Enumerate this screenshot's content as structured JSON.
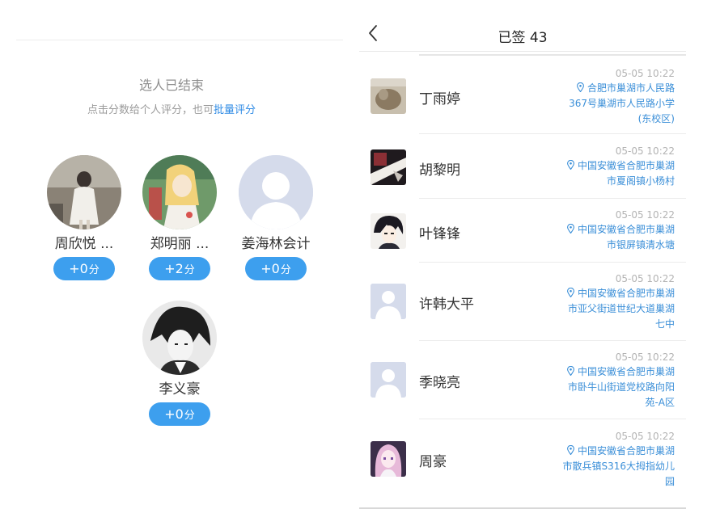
{
  "left": {
    "status_title": "选人已结束",
    "hint_prefix": "点击分数给个人评分，也可",
    "hint_link": "批量评分",
    "people": [
      {
        "name": "周欣悦 ...",
        "score": "+0",
        "unit": "分"
      },
      {
        "name": "郑明丽 ...",
        "score": "+2",
        "unit": "分"
      },
      {
        "name": "姜海林会计",
        "score": "+0",
        "unit": "分"
      },
      {
        "name": "李义豪",
        "score": "+0",
        "unit": "分"
      }
    ]
  },
  "right": {
    "title": "已签 43",
    "rows": [
      {
        "name": "丁雨婷",
        "time": "05-05 10:22",
        "location_lines": [
          "合肥市巢湖市人民路",
          "367号巢湖市人民路小学",
          "(东校区)"
        ]
      },
      {
        "name": "胡黎明",
        "time": "05-05 10:22",
        "location_lines": [
          "中国安徽省合肥市巢湖",
          "市夏阁镇小杨村"
        ]
      },
      {
        "name": "叶锋锋",
        "time": "05-05 10:22",
        "location_lines": [
          "中国安徽省合肥市巢湖",
          "市银屏镇清水塘"
        ]
      },
      {
        "name": "许韩大平",
        "time": "05-05 10:22",
        "location_lines": [
          "中国安徽省合肥市巢湖",
          "市亚父街道世纪大道巢湖",
          "七中"
        ]
      },
      {
        "name": "季晓亮",
        "time": "05-05 10:22",
        "location_lines": [
          "中国安徽省合肥市巢湖",
          "市卧牛山街道党校路向阳",
          "苑-A区"
        ]
      },
      {
        "name": "周豪",
        "time": "05-05 10:22",
        "location_lines": [
          "中国安徽省合肥市巢湖",
          "市散兵镇S316大拇指幼儿",
          "园"
        ]
      }
    ]
  },
  "colors": {
    "accent": "#3d9fee",
    "link": "#2f8be5",
    "location": "#3b8fd8",
    "placeholder": "#d9dff0"
  }
}
